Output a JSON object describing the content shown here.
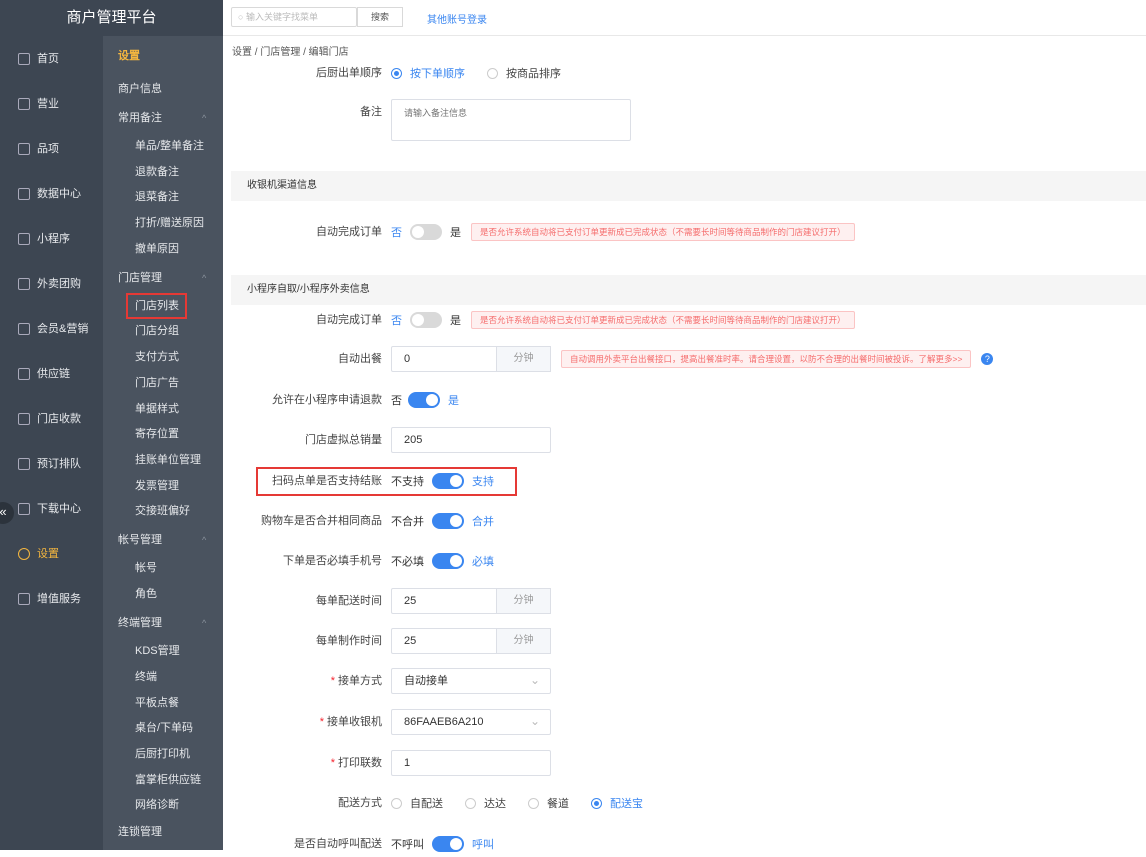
{
  "brand": "商户管理平台",
  "topbar": {
    "search_placeholder": "输入关键字找菜单",
    "search_button": "搜索",
    "other_login": "其他账号登录"
  },
  "nav_primary": [
    "首页",
    "营业",
    "品项",
    "数据中心",
    "小程序",
    "外卖团购",
    "会员&营销",
    "供应链",
    "门店收款",
    "预订排队",
    "下载中心",
    "设置",
    "增值服务"
  ],
  "nav_primary_active": "设置",
  "nav_secondary": {
    "header": "设置",
    "items": [
      {
        "label": "商户信息",
        "type": "item"
      },
      {
        "label": "常用备注",
        "type": "group"
      },
      {
        "label": "单品/整单备注",
        "type": "sub"
      },
      {
        "label": "退款备注",
        "type": "sub"
      },
      {
        "label": "退菜备注",
        "type": "sub"
      },
      {
        "label": "打折/赠送原因",
        "type": "sub"
      },
      {
        "label": "撤单原因",
        "type": "sub"
      },
      {
        "label": "门店管理",
        "type": "group"
      },
      {
        "label": "门店列表",
        "type": "sub"
      },
      {
        "label": "门店分组",
        "type": "sub"
      },
      {
        "label": "支付方式",
        "type": "sub"
      },
      {
        "label": "门店广告",
        "type": "sub"
      },
      {
        "label": "单据样式",
        "type": "sub"
      },
      {
        "label": "寄存位置",
        "type": "sub"
      },
      {
        "label": "挂账单位管理",
        "type": "sub"
      },
      {
        "label": "发票管理",
        "type": "sub"
      },
      {
        "label": "交接班偏好",
        "type": "sub"
      },
      {
        "label": "帐号管理",
        "type": "group"
      },
      {
        "label": "帐号",
        "type": "sub"
      },
      {
        "label": "角色",
        "type": "sub"
      },
      {
        "label": "终端管理",
        "type": "group"
      },
      {
        "label": "KDS管理",
        "type": "sub"
      },
      {
        "label": "终端",
        "type": "sub"
      },
      {
        "label": "平板点餐",
        "type": "sub"
      },
      {
        "label": "桌台/下单码",
        "type": "sub"
      },
      {
        "label": "后厨打印机",
        "type": "sub"
      },
      {
        "label": "富掌柜供应链",
        "type": "sub"
      },
      {
        "label": "网络诊断",
        "type": "sub"
      },
      {
        "label": "连锁管理",
        "type": "item"
      }
    ]
  },
  "breadcrumb": "设置 / 门店管理 / 编辑门店",
  "form": {
    "kitchen_order": {
      "label": "后厨出单顺序",
      "options": [
        "按下单顺序",
        "按商品排序"
      ]
    },
    "remark": {
      "label": "备注",
      "placeholder": "请输入备注信息"
    },
    "section_cashier": "收银机渠道信息",
    "cashier_auto": {
      "label": "自动完成订单",
      "off": "否",
      "on": "是",
      "tip": "是否允许系统自动将已支付订单更新成已完成状态（不需要长时间等待商品制作的门店建议打开）"
    },
    "section_mini": "小程序自取/小程序外卖信息",
    "mini_auto": {
      "label": "自动完成订单",
      "off": "否",
      "on": "是",
      "tip": "是否允许系统自动将已支付订单更新成已完成状态（不需要长时间等待商品制作的门店建议打开）"
    },
    "auto_meal": {
      "label": "自动出餐",
      "value": "0",
      "unit": "分钟",
      "tip": "自动调用外卖平台出餐接口，提高出餐准时率。请合理设置，以防不合理的出餐时间被投诉。了解更多>>",
      "help": "?"
    },
    "refund": {
      "label": "允许在小程序申请退款",
      "off": "否",
      "on": "是"
    },
    "virtual_sales": {
      "label": "门店虚拟总销量",
      "value": "205"
    },
    "scan_settle": {
      "label": "扫码点单是否支持结账",
      "off": "不支持",
      "on": "支持"
    },
    "cart_merge": {
      "label": "购物车是否合并相同商品",
      "off": "不合并",
      "on": "合并"
    },
    "phone_required": {
      "label": "下单是否必填手机号",
      "off": "不必填",
      "on": "必填"
    },
    "delivery_time": {
      "label": "每单配送时间",
      "value": "25",
      "unit": "分钟"
    },
    "making_time": {
      "label": "每单制作时间",
      "value": "25",
      "unit": "分钟"
    },
    "accept_mode": {
      "label": "接单方式",
      "value": "自动接单"
    },
    "accept_cashier": {
      "label": "接单收银机",
      "value": "86FAAEB6A210"
    },
    "print_copies": {
      "label": "打印联数",
      "value": "1"
    },
    "delivery_mode": {
      "label": "配送方式",
      "options": [
        "自配送",
        "达达",
        "餐道",
        "配送宝"
      ]
    },
    "auto_call": {
      "label": "是否自动呼叫配送",
      "off": "不呼叫",
      "on": "呼叫"
    }
  }
}
